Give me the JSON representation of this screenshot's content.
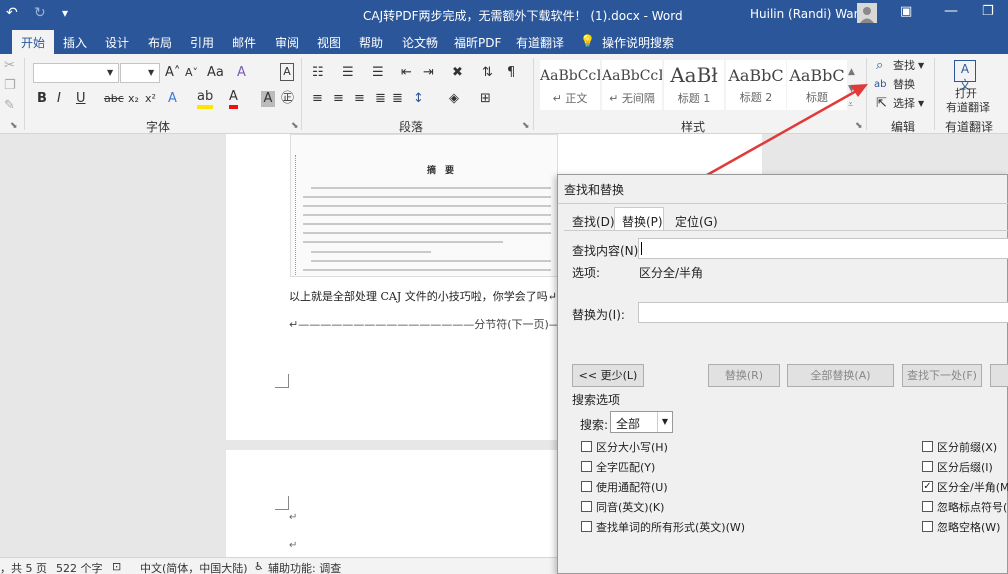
{
  "titlebar": {
    "doc_title": "CAJ转PDF两步完成，无需额外下载软件！ (1).docx  -  Word",
    "user_name": "Huilin (Randi) Wang"
  },
  "tabs": [
    "开始",
    "插入",
    "设计",
    "布局",
    "引用",
    "邮件",
    "审阅",
    "视图",
    "帮助",
    "论文畅",
    "福昕PDF",
    "有道翻译"
  ],
  "tell_me": "操作说明搜索",
  "ribbon": {
    "font_group": "字体",
    "paragraph_group": "段落",
    "styles_group": "样式",
    "edit_group": "编辑",
    "translate_group": "有道翻译",
    "styles": [
      {
        "preview": "AaBbCcDc",
        "name": "↵ 正文"
      },
      {
        "preview": "AaBbCcDc",
        "name": "↵ 无间隔"
      },
      {
        "preview": "AaBł",
        "name": "标题 1"
      },
      {
        "preview": "AaBbC",
        "name": "标题 2"
      },
      {
        "preview": "AaBbC",
        "name": "标题"
      }
    ],
    "find_label": "查找",
    "replace_label": "替换",
    "select_label": "选择",
    "open_label": "打开",
    "youdao_label": "有道翻译"
  },
  "document": {
    "abstract_heading": "摘　要",
    "body_text": "以上就是全部处理 CAJ 文件的小技巧啦，你学会了吗↵",
    "section_break": "↵————————————————分节符(下一页)————"
  },
  "statusbar": {
    "pages": "，共 5 页",
    "words": "522 个字",
    "language": "中文(简体，中国大陆)",
    "accessibility": "辅助功能: 调查"
  },
  "dialog": {
    "title": "查找和替换",
    "tabs": [
      "查找(D)",
      "替换(P)",
      "定位(G)"
    ],
    "find_label": "查找内容(N):",
    "options_label": "选项:",
    "options_value": "区分全/半角",
    "replace_label": "替换为(I):",
    "less_button": "<< 更少(L)",
    "replace_button": "替换(R)",
    "replace_all_button": "全部替换(A)",
    "find_next_button": "查找下一处(F)",
    "search_options_header": "搜索选项",
    "search_label": "搜索:",
    "search_value": "全部",
    "left_options": [
      {
        "label": "区分大小写(H)",
        "checked": false
      },
      {
        "label": "全字匹配(Y)",
        "checked": false
      },
      {
        "label": "使用通配符(U)",
        "checked": false
      },
      {
        "label": "同音(英文)(K)",
        "checked": false
      },
      {
        "label": "查找单词的所有形式(英文)(W)",
        "checked": false
      }
    ],
    "right_options": [
      {
        "label": "区分前缀(X)",
        "checked": false
      },
      {
        "label": "区分后缀(I)",
        "checked": false
      },
      {
        "label": "区分全/半角(M)",
        "checked": true
      },
      {
        "label": "忽略标点符号(S)",
        "checked": false
      },
      {
        "label": "忽略空格(W)",
        "checked": false
      }
    ]
  },
  "colors": {
    "word_blue": "#2b579a",
    "arrow_red": "#e03a3a"
  }
}
